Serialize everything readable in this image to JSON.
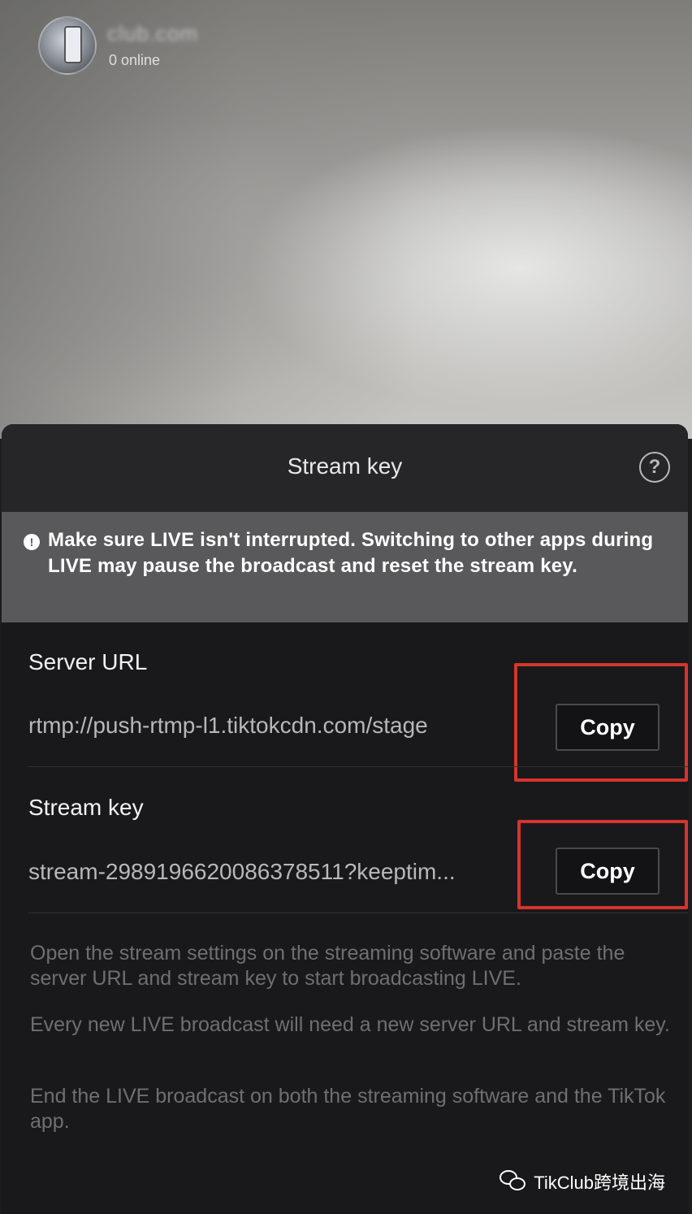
{
  "profile": {
    "account_name": "club.com",
    "online_count": "0 online"
  },
  "sheet": {
    "title": "Stream key",
    "help_icon": "question-circle-icon",
    "warning": {
      "icon": "exclamation-circle-icon",
      "text": "Make sure LIVE isn't interrupted. Switching to other apps during LIVE may pause the broadcast and reset the stream key."
    },
    "server_url": {
      "label": "Server URL",
      "value": "rtmp://push-rtmp-l1.tiktokcdn.com/stage",
      "copy_label": "Copy"
    },
    "stream_key": {
      "label": "Stream key",
      "value": "stream-2989196620086378511?keeptim...",
      "copy_label": "Copy"
    },
    "instructions": [
      "Open the stream settings on the streaming software and paste the server URL and stream key to start broadcasting LIVE.",
      "Every new LIVE broadcast will need a new server URL and stream key.",
      "End the LIVE broadcast on both the streaming software and the TikTok app."
    ]
  },
  "watermark": {
    "icon": "wechat-icon",
    "text": "TikClub跨境出海"
  },
  "colors": {
    "highlight": "#d5352d",
    "warning_bg": "#59595b",
    "sheet_bg": "#19191b"
  }
}
